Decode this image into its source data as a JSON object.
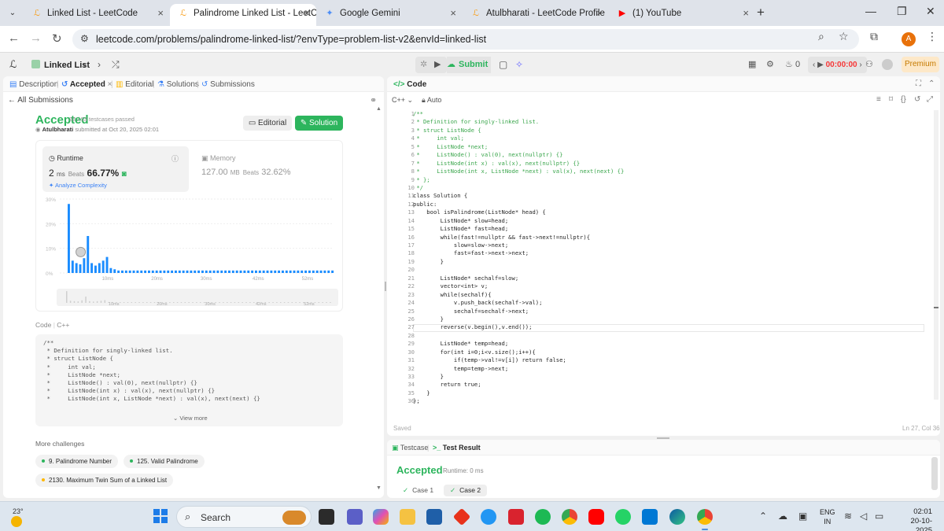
{
  "browser": {
    "tabs": [
      {
        "title": "Linked List - LeetCode",
        "icon": "leetcode-icon"
      },
      {
        "title": "Palindrome Linked List - LeetCo",
        "icon": "leetcode-icon",
        "active": true
      },
      {
        "title": "Google Gemini",
        "icon": "gemini-icon"
      },
      {
        "title": "Atulbharati - LeetCode Profile",
        "icon": "leetcode-icon"
      },
      {
        "title": "(1) YouTube",
        "icon": "youtube-icon"
      }
    ],
    "url": "leetcode.com/problems/palindrome-linked-list/?envType=problem-list-v2&envId=linked-list",
    "profile_initial": "A"
  },
  "lcbar": {
    "list_name": "Linked List",
    "submit_label": "Submit",
    "streak": "0",
    "timer": "00:00:00",
    "premium": "Premium"
  },
  "left_tabs": {
    "description": "Description",
    "accepted": "Accepted",
    "editorial": "Editorial",
    "solutions": "Solutions",
    "submissions": "Submissions"
  },
  "all_submissions": "All Submissions",
  "submission": {
    "status": "Accepted",
    "testcases": "93 / 93 testcases passed",
    "username": "Atulbharati",
    "submitted_at": "submitted at Oct 20, 2025 02:01",
    "editorial_btn": "Editorial",
    "solution_btn": "Solution"
  },
  "runtime": {
    "title": "Runtime",
    "value": "2",
    "unit": "ms",
    "beats_label": "Beats",
    "beats_pct": "66.77%",
    "analyze": "Analyze Complexity"
  },
  "memory": {
    "title": "Memory",
    "value": "127.00",
    "unit": "MB",
    "beats_label": "Beats",
    "beats_pct": "32.62%"
  },
  "chart_data": {
    "type": "bar",
    "x_ticks": [
      "10ms",
      "20ms",
      "30ms",
      "42ms",
      "52ms"
    ],
    "y_ticks": [
      "20%",
      "10%",
      "0%"
    ],
    "ylim": [
      0,
      30
    ],
    "y_tick_values": [
      30,
      20,
      10,
      0
    ],
    "y_labels": [
      "30%",
      "20%",
      "10%",
      "0%"
    ],
    "values": [
      28,
      5,
      4,
      3.5,
      6,
      15,
      4,
      3,
      4,
      5,
      6.5,
      2,
      1.5,
      1,
      1,
      1,
      1,
      1,
      1,
      1,
      1,
      1,
      1,
      1,
      1,
      1,
      1,
      1,
      1,
      1,
      1,
      1,
      1,
      1,
      1,
      1,
      1,
      1,
      1,
      1,
      1,
      1,
      1,
      1,
      1,
      1,
      1,
      1,
      1,
      1,
      1,
      1,
      1,
      1,
      1,
      1,
      1,
      1,
      1,
      1,
      1,
      1,
      1,
      1,
      1,
      1,
      1,
      1,
      1,
      1
    ],
    "highlight_index": 3,
    "color": "#1a8cff",
    "mini_ticks": [
      "10ms",
      "20ms",
      "30ms",
      "42ms",
      "52ms"
    ]
  },
  "code_preview": {
    "label": "Code",
    "lang": "C++",
    "lines": [
      "/**",
      " * Definition for singly-linked list.",
      " * struct ListNode {",
      " *     int val;",
      " *     ListNode *next;",
      " *     ListNode() : val(0), next(nullptr) {}",
      " *     ListNode(int x) : val(x), next(nullptr) {}",
      " *     ListNode(int x, ListNode *next) : val(x), next(next) {}"
    ],
    "view_more": "View more"
  },
  "more_challenges": {
    "title": "More challenges",
    "items": [
      {
        "label": "9. Palindrome Number",
        "dot": "#2db55d"
      },
      {
        "label": "125. Valid Palindrome",
        "dot": "#2db55d"
      },
      {
        "label": "2130. Maximum Twin Sum of a Linked List",
        "dot": "#ffb800"
      }
    ]
  },
  "editor": {
    "title": "Code",
    "lang": "C++",
    "auto": "Auto",
    "status_left": "Saved",
    "status_right": "Ln 27, Col 36",
    "lines": [
      "/**",
      " * Definition for singly-linked list.",
      " * struct ListNode {",
      " *     int val;",
      " *     ListNode *next;",
      " *     ListNode() : val(0), next(nullptr) {}",
      " *     ListNode(int x) : val(x), next(nullptr) {}",
      " *     ListNode(int x, ListNode *next) : val(x), next(next) {}",
      " * };",
      " */",
      "class Solution {",
      "public:",
      "    bool isPalindrome(ListNode* head) {",
      "        ListNode* slow=head;",
      "        ListNode* fast=head;",
      "        while(fast!=nullptr && fast->next!=nullptr){",
      "            slow=slow->next;",
      "            fast=fast->next->next;",
      "        }",
      "",
      "        ListNode* sechalf=slow;",
      "        vector<int> v;",
      "        while(sechalf){",
      "            v.push_back(sechalf->val);",
      "            sechalf=sechalf->next;",
      "        }",
      "        reverse(v.begin(),v.end());",
      "",
      "        ListNode* temp=head;",
      "        for(int i=0;i<v.size();i++){",
      "            if(temp->val!=v[i]) return false;",
      "            temp=temp->next;",
      "        }",
      "        return true;",
      "    }",
      "};"
    ]
  },
  "bottom": {
    "tab_testcase": "Testcase",
    "tab_result": "Test Result",
    "status": "Accepted",
    "runtime": "Runtime: 0 ms",
    "cases": [
      "Case 1",
      "Case 2"
    ]
  },
  "taskbar": {
    "temp": "23°",
    "search": "Search",
    "lang1": "ENG",
    "lang2": "IN",
    "time": "02:01",
    "date": "20-10-2025"
  }
}
